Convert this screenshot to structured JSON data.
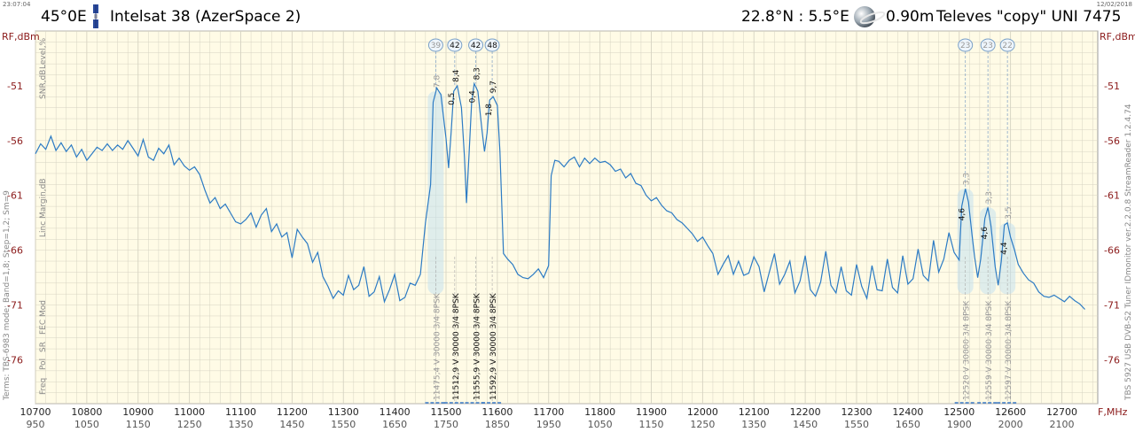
{
  "header": {
    "time": "23:07:04",
    "date": "12/02/2018",
    "position": "45°0E",
    "satellite": "Intelsat 38 (AzerSpace 2)",
    "coords": "22.8°N : 5.5°E",
    "dish": "0.90m",
    "lnb": "Televes \"copy\" UNI 7475"
  },
  "side_text": {
    "left_footer": "Terms:  TBS-6983 mode; Band=1,8; Step=1,2; Sm=9",
    "right_footer": "TBS 5927 USB DVB-S2 Tuner   IDmonitor  ver.2.2.0.8  StreamReader 1.2.4.74",
    "level": "Level,%",
    "snr": "SNR,dB",
    "link_margin": "Linc Margin,dB",
    "row_labels": [
      "Freq",
      "Pol",
      "SR",
      "FEC",
      "Mod"
    ]
  },
  "chart_data": {
    "type": "line",
    "title": "",
    "xlabel": "F,MHz",
    "ylabel": "RF,dBm",
    "xlim": [
      10700,
      12770
    ],
    "ylim": [
      -80,
      -46
    ],
    "x_ticks": [
      10700,
      10800,
      10900,
      11000,
      11100,
      11200,
      11300,
      11400,
      11500,
      11600,
      11700,
      11800,
      11900,
      12000,
      12100,
      12200,
      12300,
      12400,
      12500,
      12600,
      12700
    ],
    "if_ticks": [
      "950",
      "1050",
      "1150",
      "1250",
      "1350",
      "1450",
      "1550",
      "1650",
      "1750",
      "1850",
      "1950",
      "2050",
      "2150",
      "2250",
      "2350",
      "2450",
      "2550",
      "2650",
      "2750",
      "2850",
      "2950"
    ],
    "if_ticks_shown": [
      "950",
      "1050",
      "1150",
      "1250",
      "1350",
      "1450",
      "1550",
      "1650",
      "1750",
      "1850",
      "1950",
      "1050",
      "1150",
      "1250",
      "1350",
      "1450",
      "1550",
      "1650",
      "1900",
      "2000",
      "2100"
    ],
    "y_ticks": [
      -51,
      -56,
      -61,
      -66,
      -71,
      -76
    ],
    "grid": true,
    "series": [
      {
        "name": "",
        "points": [
          [
            10700,
            -57.2
          ],
          [
            10710,
            -56.3
          ],
          [
            10720,
            -56.8
          ],
          [
            10730,
            -55.6
          ],
          [
            10740,
            -56.9
          ],
          [
            10750,
            -56.2
          ],
          [
            10760,
            -57.0
          ],
          [
            10770,
            -56.4
          ],
          [
            10780,
            -57.5
          ],
          [
            10790,
            -56.8
          ],
          [
            10800,
            -57.8
          ],
          [
            10810,
            -57.2
          ],
          [
            10820,
            -56.6
          ],
          [
            10830,
            -56.9
          ],
          [
            10840,
            -56.3
          ],
          [
            10850,
            -56.9
          ],
          [
            10860,
            -56.4
          ],
          [
            10870,
            -56.8
          ],
          [
            10880,
            -56.0
          ],
          [
            10890,
            -56.7
          ],
          [
            10900,
            -57.4
          ],
          [
            10910,
            -55.9
          ],
          [
            10920,
            -57.5
          ],
          [
            10930,
            -57.8
          ],
          [
            10940,
            -56.7
          ],
          [
            10950,
            -57.2
          ],
          [
            10960,
            -56.4
          ],
          [
            10970,
            -58.2
          ],
          [
            10980,
            -57.6
          ],
          [
            10990,
            -58.3
          ],
          [
            11000,
            -58.7
          ],
          [
            11010,
            -58.4
          ],
          [
            11020,
            -59.1
          ],
          [
            11030,
            -60.5
          ],
          [
            11040,
            -61.7
          ],
          [
            11050,
            -61.2
          ],
          [
            11060,
            -62.2
          ],
          [
            11070,
            -61.8
          ],
          [
            11080,
            -62.6
          ],
          [
            11090,
            -63.4
          ],
          [
            11100,
            -63.6
          ],
          [
            11110,
            -63.2
          ],
          [
            11120,
            -62.6
          ],
          [
            11130,
            -63.9
          ],
          [
            11140,
            -62.8
          ],
          [
            11150,
            -62.2
          ],
          [
            11160,
            -64.3
          ],
          [
            11170,
            -63.6
          ],
          [
            11180,
            -64.8
          ],
          [
            11190,
            -64.4
          ],
          [
            11200,
            -66.7
          ],
          [
            11210,
            -64.1
          ],
          [
            11220,
            -64.8
          ],
          [
            11230,
            -65.4
          ],
          [
            11240,
            -67.1
          ],
          [
            11250,
            -66.2
          ],
          [
            11260,
            -68.4
          ],
          [
            11270,
            -69.3
          ],
          [
            11280,
            -70.4
          ],
          [
            11290,
            -69.7
          ],
          [
            11300,
            -70.1
          ],
          [
            11310,
            -68.3
          ],
          [
            11320,
            -69.6
          ],
          [
            11330,
            -69.2
          ],
          [
            11340,
            -67.5
          ],
          [
            11350,
            -70.2
          ],
          [
            11360,
            -69.8
          ],
          [
            11370,
            -68.4
          ],
          [
            11380,
            -70.7
          ],
          [
            11390,
            -69.6
          ],
          [
            11400,
            -68.2
          ],
          [
            11410,
            -70.6
          ],
          [
            11420,
            -70.3
          ],
          [
            11430,
            -69.0
          ],
          [
            11440,
            -69.2
          ],
          [
            11450,
            -68.2
          ],
          [
            11460,
            -63.5
          ],
          [
            11470,
            -60.0
          ],
          [
            11475,
            -52.5
          ],
          [
            11482,
            -51.2
          ],
          [
            11490,
            -51.8
          ],
          [
            11500,
            -55.8
          ],
          [
            11505,
            -58.5
          ],
          [
            11510,
            -55.2
          ],
          [
            11515,
            -51.5
          ],
          [
            11522,
            -51.0
          ],
          [
            11530,
            -53.0
          ],
          [
            11536,
            -57.5
          ],
          [
            11540,
            -61.7
          ],
          [
            11545,
            -57.2
          ],
          [
            11550,
            -52.5
          ],
          [
            11555,
            -50.8
          ],
          [
            11562,
            -51.5
          ],
          [
            11570,
            -55.0
          ],
          [
            11575,
            -57.0
          ],
          [
            11580,
            -55.3
          ],
          [
            11585,
            -52.3
          ],
          [
            11592,
            -52.0
          ],
          [
            11600,
            -52.8
          ],
          [
            11605,
            -57.0
          ],
          [
            11612,
            -66.3
          ],
          [
            11620,
            -66.8
          ],
          [
            11630,
            -67.3
          ],
          [
            11640,
            -68.2
          ],
          [
            11650,
            -68.5
          ],
          [
            11660,
            -68.6
          ],
          [
            11670,
            -68.2
          ],
          [
            11680,
            -67.7
          ],
          [
            11690,
            -68.5
          ],
          [
            11700,
            -67.4
          ],
          [
            11705,
            -59.2
          ],
          [
            11712,
            -57.8
          ],
          [
            11720,
            -57.9
          ],
          [
            11730,
            -58.4
          ],
          [
            11740,
            -57.8
          ],
          [
            11750,
            -57.5
          ],
          [
            11760,
            -58.4
          ],
          [
            11770,
            -57.6
          ],
          [
            11780,
            -58.1
          ],
          [
            11790,
            -57.6
          ],
          [
            11800,
            -58.0
          ],
          [
            11810,
            -57.9
          ],
          [
            11820,
            -58.2
          ],
          [
            11830,
            -58.8
          ],
          [
            11840,
            -58.6
          ],
          [
            11850,
            -59.4
          ],
          [
            11860,
            -59.0
          ],
          [
            11870,
            -59.9
          ],
          [
            11880,
            -60.1
          ],
          [
            11890,
            -61.0
          ],
          [
            11900,
            -61.5
          ],
          [
            11910,
            -61.2
          ],
          [
            11920,
            -61.9
          ],
          [
            11930,
            -62.4
          ],
          [
            11940,
            -62.6
          ],
          [
            11950,
            -63.2
          ],
          [
            11960,
            -63.5
          ],
          [
            11970,
            -64.0
          ],
          [
            11980,
            -64.5
          ],
          [
            11990,
            -65.2
          ],
          [
            12000,
            -64.8
          ],
          [
            12010,
            -65.6
          ],
          [
            12020,
            -66.3
          ],
          [
            12030,
            -68.2
          ],
          [
            12040,
            -67.3
          ],
          [
            12050,
            -66.5
          ],
          [
            12060,
            -68.2
          ],
          [
            12070,
            -67.0
          ],
          [
            12080,
            -68.3
          ],
          [
            12090,
            -68.1
          ],
          [
            12100,
            -66.6
          ],
          [
            12110,
            -67.5
          ],
          [
            12120,
            -69.8
          ],
          [
            12130,
            -68.0
          ],
          [
            12140,
            -66.3
          ],
          [
            12150,
            -69.1
          ],
          [
            12160,
            -68.2
          ],
          [
            12170,
            -67.0
          ],
          [
            12180,
            -69.9
          ],
          [
            12190,
            -68.8
          ],
          [
            12200,
            -66.5
          ],
          [
            12210,
            -69.6
          ],
          [
            12220,
            -70.2
          ],
          [
            12230,
            -68.9
          ],
          [
            12240,
            -66.1
          ],
          [
            12250,
            -69.2
          ],
          [
            12260,
            -69.9
          ],
          [
            12270,
            -67.5
          ],
          [
            12280,
            -69.7
          ],
          [
            12290,
            -70.1
          ],
          [
            12300,
            -67.3
          ],
          [
            12310,
            -69.3
          ],
          [
            12320,
            -70.4
          ],
          [
            12330,
            -67.4
          ],
          [
            12340,
            -69.6
          ],
          [
            12350,
            -69.7
          ],
          [
            12360,
            -66.8
          ],
          [
            12370,
            -69.4
          ],
          [
            12380,
            -69.9
          ],
          [
            12390,
            -66.5
          ],
          [
            12400,
            -69.1
          ],
          [
            12410,
            -68.6
          ],
          [
            12420,
            -65.9
          ],
          [
            12430,
            -68.3
          ],
          [
            12440,
            -68.8
          ],
          [
            12450,
            -65.1
          ],
          [
            12460,
            -68.0
          ],
          [
            12470,
            -66.8
          ],
          [
            12480,
            -64.4
          ],
          [
            12490,
            -66.2
          ],
          [
            12500,
            -66.9
          ],
          [
            12505,
            -62.0
          ],
          [
            12512,
            -60.4
          ],
          [
            12518,
            -61.6
          ],
          [
            12525,
            -64.6
          ],
          [
            12530,
            -66.6
          ],
          [
            12536,
            -68.5
          ],
          [
            12542,
            -66.8
          ],
          [
            12550,
            -63.1
          ],
          [
            12556,
            -62.1
          ],
          [
            12562,
            -63.8
          ],
          [
            12570,
            -67.5
          ],
          [
            12576,
            -69.2
          ],
          [
            12582,
            -67.0
          ],
          [
            12588,
            -63.7
          ],
          [
            12594,
            -63.5
          ],
          [
            12600,
            -64.8
          ],
          [
            12608,
            -66.0
          ],
          [
            12615,
            -67.3
          ],
          [
            12625,
            -68.1
          ],
          [
            12635,
            -68.7
          ],
          [
            12645,
            -69.0
          ],
          [
            12655,
            -69.8
          ],
          [
            12665,
            -70.2
          ],
          [
            12675,
            -70.3
          ],
          [
            12685,
            -70.1
          ],
          [
            12695,
            -70.4
          ],
          [
            12705,
            -70.7
          ],
          [
            12715,
            -70.2
          ],
          [
            12725,
            -70.6
          ],
          [
            12735,
            -70.9
          ],
          [
            12745,
            -71.4
          ]
        ]
      }
    ],
    "carriers": [
      {
        "freq_label": "11475,4",
        "pol": "V",
        "sr": "30000",
        "fec": "3/4",
        "mod": "8PSK",
        "level": "39",
        "snr": "7,8",
        "margin": "",
        "locked": false,
        "center": 11480,
        "top": -51.5
      },
      {
        "freq_label": "11512,9",
        "pol": "V",
        "sr": "30000",
        "fec": "3/4",
        "mod": "8PSK",
        "level": "42",
        "snr": "8,4",
        "margin": "0,5",
        "locked": true,
        "center": 11517,
        "top": -51.0
      },
      {
        "freq_label": "11555,9",
        "pol": "V",
        "sr": "30000",
        "fec": "3/4",
        "mod": "8PSK",
        "level": "42",
        "snr": "8,3",
        "margin": "0,4",
        "locked": true,
        "center": 11558,
        "top": -50.8
      },
      {
        "freq_label": "11592,9",
        "pol": "V",
        "sr": "30000",
        "fec": "3/4",
        "mod": "8PSK",
        "level": "48",
        "snr": "9,7",
        "margin": "1,8",
        "locked": true,
        "center": 11590,
        "top": -52.0
      },
      {
        "freq_label": "12520",
        "pol": "V",
        "sr": "30000",
        "fec": "3/4",
        "mod": "8PSK",
        "level": "23",
        "snr": "3,3",
        "margin": "4,6",
        "locked": false,
        "center": 12512,
        "top": -60.4
      },
      {
        "freq_label": "12559",
        "pol": "V",
        "sr": "30000",
        "fec": "3/4",
        "mod": "8PSK",
        "level": "23",
        "snr": "3,3",
        "margin": "4,6",
        "locked": false,
        "center": 12556,
        "top": -62.1
      },
      {
        "freq_label": "12597",
        "pol": "V",
        "sr": "30000",
        "fec": "3/4",
        "mod": "8PSK",
        "level": "22",
        "snr": "3,5",
        "margin": "4,4",
        "locked": false,
        "center": 12594,
        "top": -63.5
      }
    ]
  },
  "colors": {
    "plot_bg": "#fffbe6",
    "grid": "#d6d3c2",
    "line": "#2c7bc4",
    "axis_text": "#8b1a1a",
    "grey_text": "#888888"
  }
}
